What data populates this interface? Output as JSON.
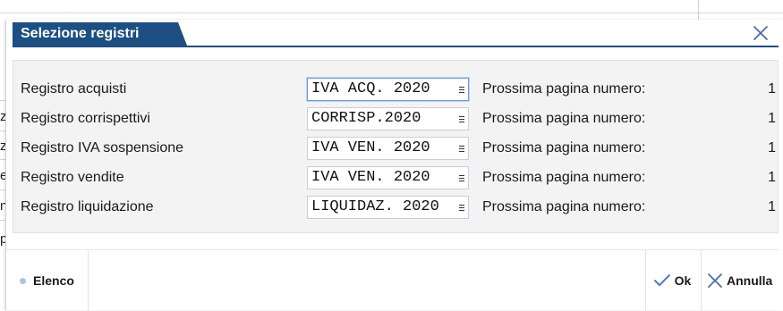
{
  "background": {
    "fragments": [
      "zi",
      "zi",
      "e",
      "n",
      "p"
    ]
  },
  "dialog": {
    "title": "Selezione registri",
    "close_icon": "close-icon"
  },
  "registers": [
    {
      "label": "Registro acquisti",
      "value": "IVA ACQ. 2020",
      "next_page_label": "Prossima pagina numero:",
      "next_page": "1",
      "focused": true
    },
    {
      "label": "Registro corrispettivi",
      "value": "CORRISP.2020",
      "next_page_label": "Prossima pagina numero:",
      "next_page": "1",
      "focused": false
    },
    {
      "label": "Registro IVA sospensione",
      "value": "IVA VEN. 2020",
      "next_page_label": "Prossima pagina numero:",
      "next_page": "1",
      "focused": false
    },
    {
      "label": "Registro vendite",
      "value": "IVA VEN. 2020",
      "next_page_label": "Prossima pagina numero:",
      "next_page": "1",
      "focused": false
    },
    {
      "label": "Registro liquidazione",
      "value": "LIQUIDAZ. 2020",
      "next_page_label": "Prossima pagina numero:",
      "next_page": "1",
      "focused": false
    }
  ],
  "footer": {
    "elenco_label": "Elenco",
    "ok_label": "Ok",
    "annulla_label": "Annulla"
  },
  "colors": {
    "title_bg": "#1c4f82",
    "accent_blue": "#4a7fc4",
    "panel_bg": "#f3f3f3"
  }
}
